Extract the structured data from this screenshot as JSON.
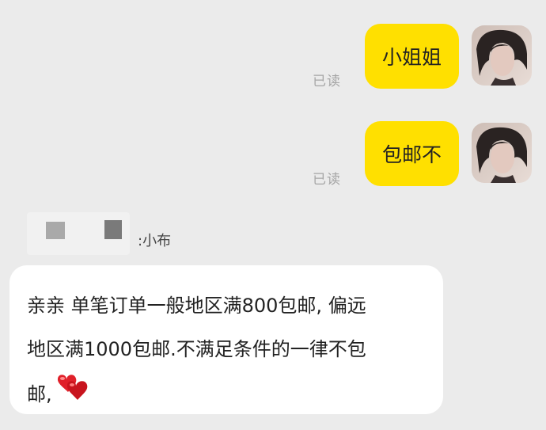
{
  "messages_out": [
    {
      "text": "小姐姐",
      "status": "已读"
    },
    {
      "text": "包邮不",
      "status": "已读"
    }
  ],
  "incoming": {
    "sender_prefix": ":小布",
    "lines": [
      "亲亲 单笔订单一般地区满800包邮, 偏远",
      "地区满1000包邮.不满足条件的一律不包",
      "邮,"
    ],
    "emoji": "hearts-icon"
  },
  "colors": {
    "background": "#ebebeb",
    "outgoing_bubble": "#ffe000",
    "incoming_bubble": "#ffffff",
    "read_status": "#a6a6a6"
  }
}
